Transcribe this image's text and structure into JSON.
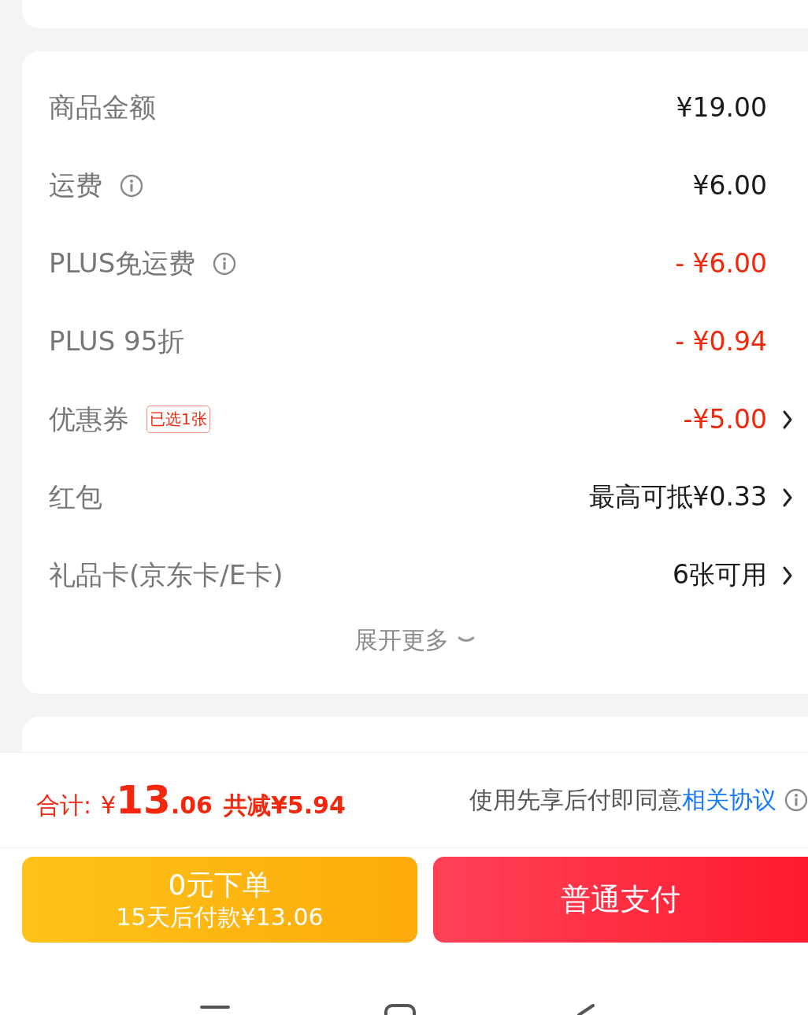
{
  "fees": {
    "rows": [
      {
        "label": "商品金额",
        "info": false,
        "value": "¥19.00",
        "kind": "amount",
        "chevron": false
      },
      {
        "label": "运费",
        "info": true,
        "value": "¥6.00",
        "kind": "amount",
        "chevron": false
      },
      {
        "label": "PLUS免运费",
        "info": true,
        "value": "- ¥6.00",
        "kind": "discount",
        "chevron": false
      },
      {
        "label": "PLUS 95折",
        "info": false,
        "value": "- ¥0.94",
        "kind": "discount",
        "chevron": false
      },
      {
        "label": "优惠券",
        "info": false,
        "badge": "已选1张",
        "value": "-¥5.00",
        "kind": "discount",
        "chevron": true
      },
      {
        "label": "红包",
        "info": false,
        "value": "最高可抵¥0.33",
        "kind": "amount",
        "chevron": true
      },
      {
        "label": "礼品卡(京东卡/E卡)",
        "info": false,
        "value": "6张可用",
        "kind": "amount",
        "chevron": true
      }
    ],
    "expand": "展开更多"
  },
  "total": {
    "label": "合计:",
    "currency": "¥",
    "integer": "13",
    "decimal": ".06",
    "savings": "共减¥5.94"
  },
  "agreement": {
    "text": "使用先享后付即同意",
    "link": "相关协议"
  },
  "buttons": {
    "pay_later": {
      "title": "0元下单",
      "subtitle": "15天后付款¥13.06"
    },
    "pay": "普通支付"
  }
}
